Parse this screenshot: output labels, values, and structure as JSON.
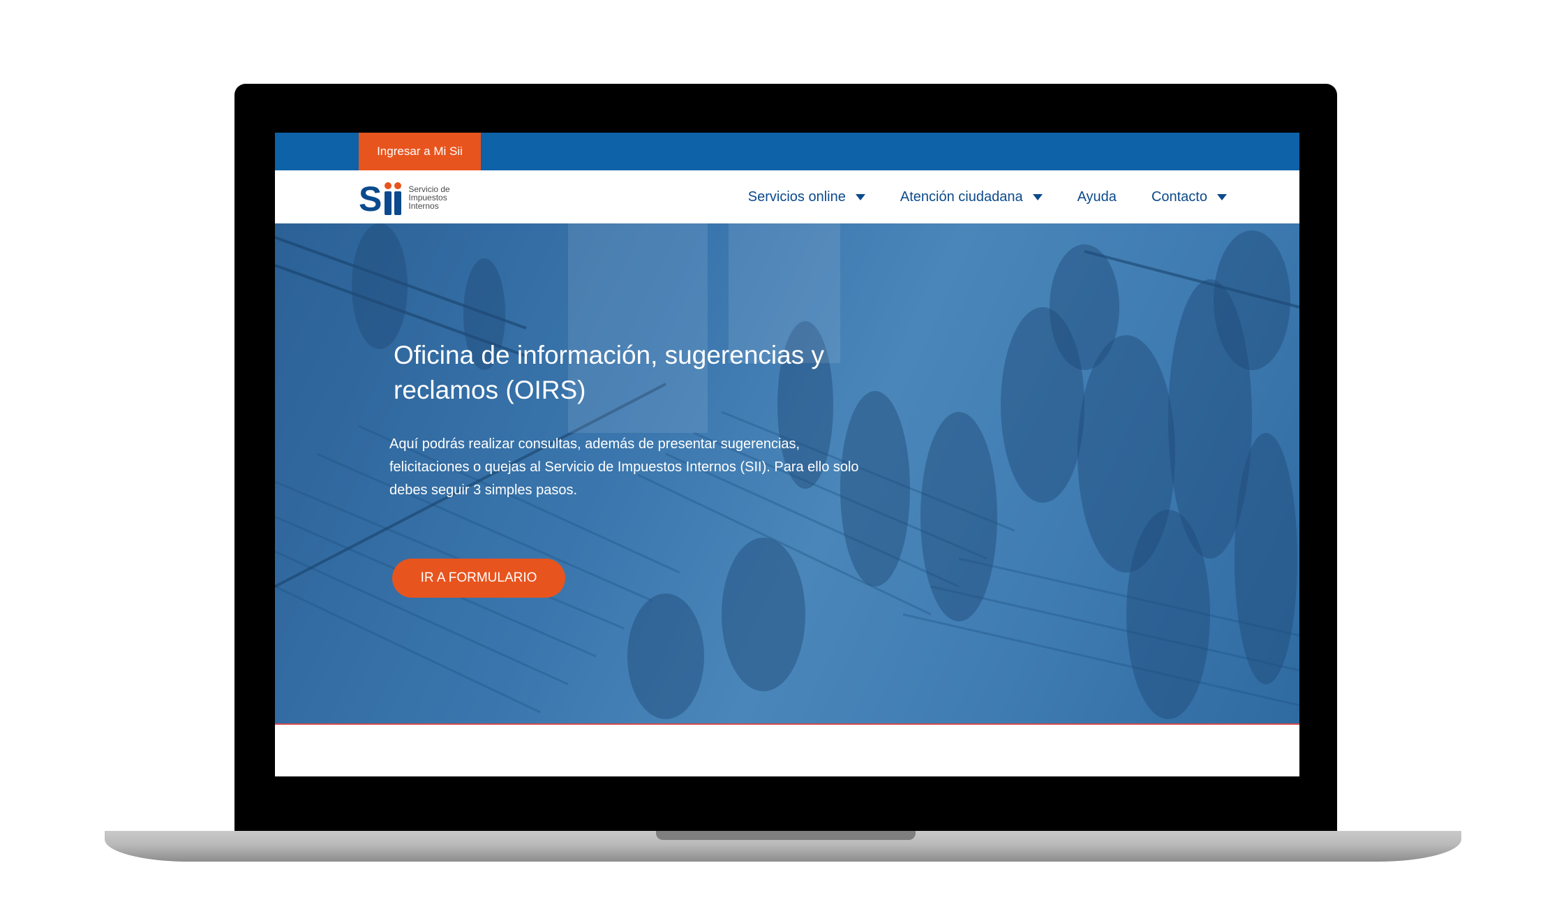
{
  "topbar": {
    "login_label": "Ingresar a Mi Sii"
  },
  "logo": {
    "mark": "S",
    "text": "Servicio de\nImpuestos\nInternos"
  },
  "nav": {
    "items": [
      {
        "label": "Servicios online",
        "icon": "caret-down-icon"
      },
      {
        "label": "Atención ciudadana",
        "icon": "caret-down-icon"
      },
      {
        "label": "Ayuda"
      },
      {
        "label": "Contacto",
        "icon": "caret-down-icon"
      }
    ]
  },
  "hero": {
    "title": "Oficina de información, sugerencias y reclamos (OIRS)",
    "text": "Aquí podrás realizar consultas, además de presentar sugerencias, felicitaciones o quejas al Servicio de Impuestos Internos (SII). Para ello solo debes seguir 3 simples pasos.",
    "button_label": "IR A FORMULARIO"
  },
  "colors": {
    "primary_blue": "#0d62a8",
    "accent_orange": "#e8541e",
    "nav_text": "#0b4a8c"
  }
}
